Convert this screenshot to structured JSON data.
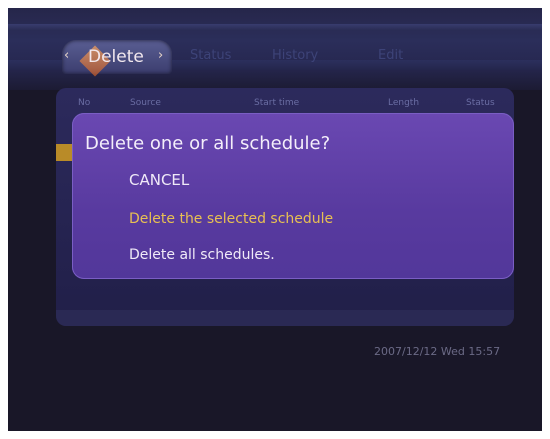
{
  "tabs": {
    "active": "Delete",
    "items": [
      "Status",
      "History",
      "Edit"
    ]
  },
  "table": {
    "columns": [
      "No",
      "Source",
      "Start time",
      "Length",
      "Status"
    ]
  },
  "dialog": {
    "title": "Delete one or all schedule?",
    "options": [
      "CANCEL",
      "Delete the selected schedule",
      "Delete all schedules."
    ],
    "selected_index": 1
  },
  "datetime": "2007/12/12 Wed 15:57",
  "colors": {
    "background": "#191728",
    "dialog": "#5f40a8",
    "highlight": "#e8c052",
    "selection_marker": "#b98b28"
  },
  "icons": {
    "tab_left": "left-arrow-icon",
    "tab_right": "right-arrow-icon"
  }
}
